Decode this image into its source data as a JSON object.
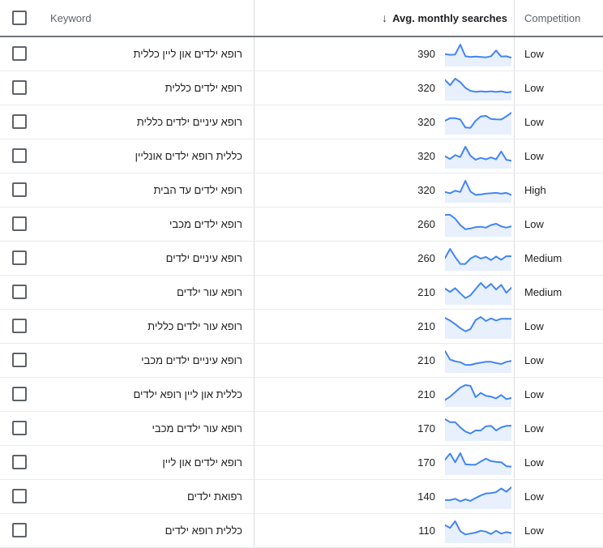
{
  "table": {
    "columns": {
      "checkbox_header": "select-all",
      "keyword": "Keyword",
      "searches": "Avg. monthly searches",
      "sort_indicator": "↓",
      "competition": "Competition"
    },
    "colors": {
      "spark_line": "#4285f4",
      "spark_fill": "#e8f0fe",
      "header_rule": "#70757a",
      "row_rule": "#e8eaed",
      "col_rule": "#dadce0",
      "text_primary": "#202124",
      "text_secondary": "#5f6368"
    },
    "rows": [
      {
        "keyword": "רופא ילדים און ליין כללית",
        "searches": "390",
        "competition": "Low",
        "trend": [
          42,
          38,
          40,
          95,
          30,
          26,
          28,
          26,
          24,
          30,
          62,
          28,
          30,
          22
        ]
      },
      {
        "keyword": "רופא ילדים כללית",
        "searches": "320",
        "competition": "Low",
        "trend": [
          72,
          48,
          78,
          62,
          36,
          22,
          18,
          20,
          18,
          20,
          17,
          20,
          15,
          17
        ]
      },
      {
        "keyword": "רופא עיניים ילדים כללית",
        "searches": "320",
        "competition": "Low",
        "trend": [
          48,
          62,
          62,
          55,
          12,
          10,
          48,
          72,
          75,
          58,
          56,
          55,
          72,
          92
        ]
      },
      {
        "keyword": "כללית רופא ילדים אונליין",
        "searches": "320",
        "competition": "Low",
        "trend": [
          38,
          24,
          44,
          34,
          86,
          40,
          20,
          30,
          22,
          32,
          22,
          62,
          20,
          15
        ]
      },
      {
        "keyword": "רופא ילדים עד הבית",
        "searches": "320",
        "competition": "High",
        "trend": [
          28,
          22,
          34,
          28,
          82,
          30,
          14,
          16,
          20,
          22,
          24,
          20,
          24,
          14
        ]
      },
      {
        "keyword": "רופא ילדים מכבי",
        "searches": "260",
        "competition": "Low",
        "trend": [
          80,
          80,
          62,
          32,
          12,
          16,
          22,
          24,
          20,
          32,
          38,
          26,
          20,
          26
        ]
      },
      {
        "keyword": "רופא עיניים ילדים",
        "searches": "260",
        "competition": "Medium",
        "trend": [
          40,
          88,
          46,
          10,
          10,
          38,
          52,
          38,
          46,
          30,
          48,
          32,
          50,
          50
        ]
      },
      {
        "keyword": "רופא עור ילדים",
        "searches": "210",
        "competition": "Medium",
        "trend": [
          48,
          34,
          50,
          28,
          8,
          20,
          46,
          72,
          50,
          68,
          44,
          64,
          30,
          52
        ]
      },
      {
        "keyword": "רופא עור ילדים כללית",
        "searches": "210",
        "competition": "Low",
        "trend": [
          72,
          60,
          44,
          26,
          12,
          22,
          62,
          76,
          58,
          70,
          60,
          68,
          68,
          68
        ]
      },
      {
        "keyword": "רופא עיניים ילדים מכבי",
        "searches": "210",
        "competition": "Low",
        "trend": [
          76,
          38,
          30,
          26,
          14,
          14,
          20,
          24,
          28,
          28,
          22,
          18,
          28,
          32
        ]
      },
      {
        "keyword": "כללית און ליין רופא ילדים",
        "searches": "210",
        "competition": "Low",
        "trend": [
          10,
          26,
          48,
          70,
          82,
          78,
          24,
          44,
          30,
          26,
          18,
          34,
          14,
          20
        ]
      },
      {
        "keyword": "רופא עור ילדים מכבי",
        "searches": "170",
        "competition": "Low",
        "trend": [
          66,
          54,
          54,
          34,
          18,
          10,
          22,
          22,
          38,
          40,
          22,
          34,
          40,
          40
        ]
      },
      {
        "keyword": "רופא ילדים און ליין",
        "searches": "170",
        "competition": "Low",
        "trend": [
          52,
          84,
          40,
          86,
          30,
          28,
          28,
          44,
          58,
          46,
          42,
          40,
          20,
          18
        ]
      },
      {
        "keyword": "רפואת ילדים",
        "searches": "140",
        "competition": "Low",
        "trend": [
          20,
          20,
          26,
          14,
          24,
          16,
          30,
          42,
          52,
          54,
          58,
          76,
          60,
          82
        ]
      },
      {
        "keyword": "כללית רופא ילדים",
        "searches": "110",
        "competition": "Low",
        "trend": [
          56,
          44,
          72,
          30,
          16,
          20,
          24,
          32,
          28,
          18,
          32,
          20,
          26,
          22
        ]
      }
    ]
  }
}
